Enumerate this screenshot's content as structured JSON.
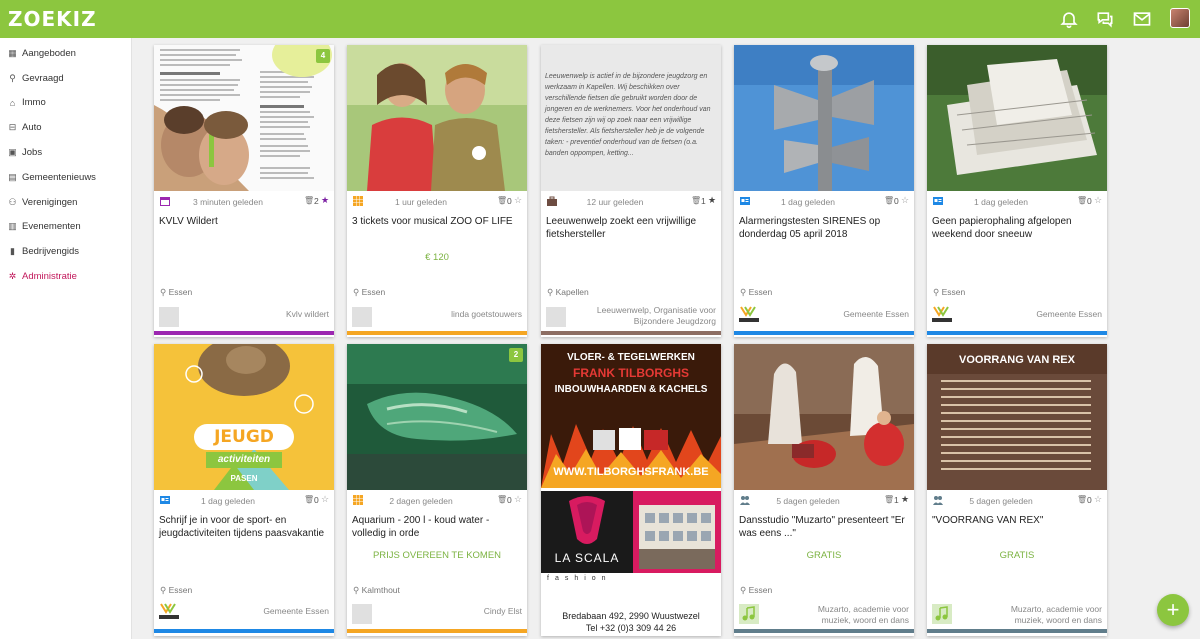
{
  "app": {
    "logo": "ZOEKIZ"
  },
  "header": {
    "icons": [
      "bell-icon",
      "chat-icon",
      "mail-icon"
    ]
  },
  "colors": {
    "brand": "#8cc63f",
    "purple": "#9c27b0",
    "orange": "#f5a623",
    "brown": "#8d6e63",
    "blue": "#1e88e5",
    "slate": "#607d8b",
    "admin": "#c2185b"
  },
  "sidebar": {
    "items": [
      {
        "label": "Aangeboden",
        "icon": "grid-icon"
      },
      {
        "label": "Gevraagd",
        "icon": "search-icon"
      },
      {
        "label": "Immo",
        "icon": "home-icon"
      },
      {
        "label": "Auto",
        "icon": "car-icon"
      },
      {
        "label": "Jobs",
        "icon": "briefcase-icon"
      },
      {
        "label": "Gemeentenieuws",
        "icon": "newspaper-icon"
      },
      {
        "label": "Verenigingen",
        "icon": "users-icon"
      },
      {
        "label": "Evenementen",
        "icon": "calendar-icon"
      },
      {
        "label": "Bedrijvengids",
        "icon": "building-icon"
      },
      {
        "label": "Administratie",
        "icon": "gear-icon"
      }
    ]
  },
  "cards": [
    {
      "badge": "4",
      "time": "3 minuten geleden",
      "count": "2",
      "starred": true,
      "title": "KVLV Wildert",
      "price": "",
      "location": "Essen",
      "seller": "Kvlv wildert",
      "category_icon": "calendar-icon"
    },
    {
      "badge": "",
      "time": "1 uur geleden",
      "count": "0",
      "starred": false,
      "title": "3 tickets voor musical ZOO OF LIFE",
      "price": "€ 120",
      "location": "Essen",
      "seller": "linda goetstouwers",
      "category_icon": "grid-icon"
    },
    {
      "badge": "",
      "time": "12 uur geleden",
      "count": "1",
      "starred": true,
      "title": "Leeuwenwelp zoekt een vrijwillige fietshersteller",
      "price": "",
      "location": "Kapellen",
      "seller": "Leeuwenwelp, Organisatie voor Bijzondere Jeugdzorg",
      "category_icon": "briefcase-icon",
      "image_text": "Leeuwenwelp is actief in de bijzondere jeugdzorg en werkzaam in Kapellen. Wij beschikken over verschillende fietsen die gebruikt worden door de jongeren en de werknemers. Voor het onderhoud van deze fietsen zijn wij op zoek naar een vrijwillige fietshersteller. Als fietshersteller heb je de volgende taken: - preventief onderhoud van de fietsen (o.a. banden oppompen, ketting..."
    },
    {
      "badge": "",
      "time": "1 dag geleden",
      "count": "0",
      "starred": false,
      "title": "Alarmeringstesten SIRENES op donderdag 05 april 2018",
      "price": "",
      "location": "Essen",
      "seller": "Gemeente Essen",
      "category_icon": "newspaper-icon"
    },
    {
      "badge": "",
      "time": "1 dag geleden",
      "count": "0",
      "starred": false,
      "title": "Geen papierophaling afgelopen weekend door sneeuw",
      "price": "",
      "location": "Essen",
      "seller": "Gemeente Essen",
      "category_icon": "newspaper-icon"
    },
    {
      "badge": "",
      "time": "1 dag geleden",
      "count": "0",
      "starred": false,
      "title": "Schrijf je in voor de sport- en jeugdactiviteiten tijdens paasvakantie",
      "price": "",
      "location": "Essen",
      "seller": "Gemeente Essen",
      "category_icon": "newspaper-icon",
      "image_text": [
        "JEUGD",
        "activiteiten",
        "PASEN"
      ]
    },
    {
      "badge": "2",
      "time": "2 dagen geleden",
      "count": "0",
      "starred": false,
      "title": "Aquarium - 200 l - koud water - volledig in orde",
      "price": "PRIJS OVEREEN TE KOMEN",
      "location": "Kalmthout",
      "seller": "Cindy Elst",
      "category_icon": "grid-icon"
    },
    {
      "badge": "",
      "time": "",
      "count": "",
      "starred": false,
      "title": "",
      "price": "",
      "location": "",
      "seller": "",
      "category_icon": "",
      "ad_top": [
        "VLOER- & TEGELWERKEN",
        "FRANK TILBORGHS",
        "INBOUWHAARDEN & KACHELS",
        "WWW.TILBORGHSFRANK.BE"
      ],
      "ad_bottom": [
        "LA SCALA",
        "fashion",
        "Bredabaan 492, 2990 Wuustwezel",
        "Tel +32 (0)3 309 44 26"
      ]
    },
    {
      "badge": "",
      "time": "5 dagen geleden",
      "count": "1",
      "starred": true,
      "title": "Dansstudio \"Muzarto\" presenteert \"Er was eens ...\"",
      "price": "GRATIS",
      "location": "Essen",
      "seller": "Muzarto, academie voor muziek, woord en dans",
      "category_icon": "users-icon"
    },
    {
      "badge": "",
      "time": "5 dagen geleden",
      "count": "0",
      "starred": false,
      "title": "\"VOORRANG VAN REX\"",
      "price": "GRATIS",
      "location": "",
      "seller": "Muzarto, academie voor muziek, woord en dans",
      "category_icon": "users-icon",
      "image_text": "VOORRANG VAN REX"
    }
  ],
  "fab": {
    "label": "+"
  }
}
